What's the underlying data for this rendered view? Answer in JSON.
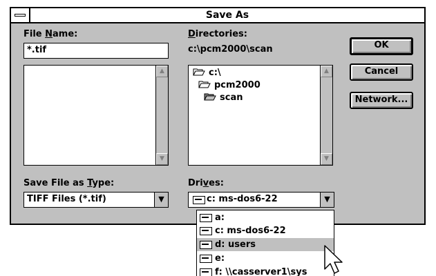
{
  "window": {
    "title": "Save As"
  },
  "file_name": {
    "label_before": "File ",
    "label_accel": "N",
    "label_after": "ame:",
    "value": "*.tif"
  },
  "directories": {
    "label_accel": "D",
    "label_after": "irectories:",
    "current_path": "c:\\pcm2000\\scan",
    "tree": [
      {
        "label": "c:\\",
        "state": "open"
      },
      {
        "label": "pcm2000",
        "state": "open"
      },
      {
        "label": "scan",
        "state": "open-selected"
      }
    ]
  },
  "save_type": {
    "label_before": "Save File as ",
    "label_accel": "T",
    "label_after": "ype:",
    "value": "TIFF Files (*.tif)"
  },
  "drives": {
    "label_before": "Dri",
    "label_accel": "v",
    "label_after": "es:",
    "value": "c: ms-dos6-22",
    "options": [
      {
        "label": "a:",
        "icon": "floppy-drive-icon"
      },
      {
        "label": "c: ms-dos6-22",
        "icon": "hard-drive-icon"
      },
      {
        "label": "d: users",
        "icon": "hard-drive-icon",
        "highlighted": true
      },
      {
        "label": "e:",
        "icon": "cdrom-drive-icon"
      },
      {
        "label": "f: \\\\casserver1\\sys",
        "icon": "network-drive-icon"
      }
    ]
  },
  "buttons": {
    "ok": "OK",
    "cancel": "Cancel",
    "network": "Network..."
  }
}
